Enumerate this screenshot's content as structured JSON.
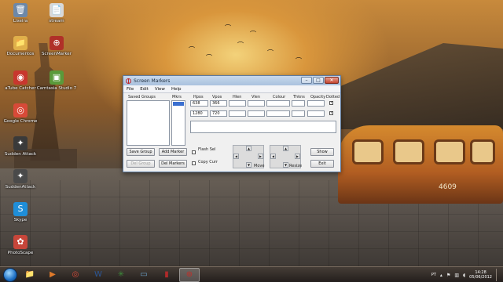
{
  "desktop": {
    "icons": [
      {
        "label": "Lixeira",
        "glyph": "🗑",
        "color": "#6d88a8"
      },
      {
        "label": "stream",
        "glyph": "📄",
        "color": "#d8d8d8"
      },
      {
        "label": "Documentos",
        "glyph": "📁",
        "color": "#e0b04a"
      },
      {
        "label": "ScreenMarker",
        "glyph": "⊕",
        "color": "#b03028"
      },
      {
        "label": "aTube Catcher",
        "glyph": "◉",
        "color": "#c8372e"
      },
      {
        "label": "Camtasia Studio 7",
        "glyph": "▣",
        "color": "#5a9a3a"
      },
      {
        "label": "Google Chrome",
        "glyph": "◎",
        "color": "#d84a38"
      },
      {
        "label": "Sudden Attack",
        "glyph": "✦",
        "color": "#3a3a3a"
      },
      {
        "label": "SuddenAttack",
        "glyph": "✦",
        "color": "#4a4a4a"
      },
      {
        "label": "Skype",
        "glyph": "S",
        "color": "#1f8ed8"
      },
      {
        "label": "PhotoScape",
        "glyph": "✿",
        "color": "#c7463a"
      }
    ],
    "train_number": "4609"
  },
  "window": {
    "title": "Screen Markers",
    "controls": {
      "minimize": "–",
      "maximize": "□",
      "close": "✕"
    },
    "menu": [
      "File",
      "Edit",
      "View",
      "Help"
    ],
    "saved_groups_label": "Saved Groups",
    "mkrs_label": "Mkrs",
    "columns": [
      "Hpos",
      "Vpos",
      "Hlen",
      "Vlen",
      "Colour",
      "Thkns",
      "Opacity",
      "Dotted"
    ],
    "rows": [
      {
        "hpos": "638",
        "vpos": "366",
        "hlen": "",
        "vlen": "",
        "colour": "",
        "thkns": "",
        "opacity": "",
        "dotted": "✓"
      },
      {
        "hpos": "1280",
        "vpos": "720",
        "hlen": "",
        "vlen": "",
        "colour": "",
        "thkns": "",
        "opacity": "",
        "dotted": "✓"
      }
    ],
    "buttons": {
      "save_group": "Save Group",
      "add_marker": "Add Marker",
      "del_group": "Del Group",
      "del_markers": "Del Markers",
      "show": "Show",
      "exit": "Exit"
    },
    "checkboxes": {
      "flash_sel": "Flash Sel",
      "copy_curr": "Copy Curr"
    },
    "pad_labels": {
      "move": "Move",
      "resize": "Resize"
    },
    "arrows": {
      "up": "▲",
      "down": "▼",
      "left": "◀",
      "right": "▶"
    }
  },
  "taskbar": {
    "apps": [
      {
        "name": "file-explorer",
        "glyph": "📁"
      },
      {
        "name": "media-player",
        "glyph": "▶"
      },
      {
        "name": "chrome",
        "glyph": "◎"
      },
      {
        "name": "word",
        "glyph": "W"
      },
      {
        "name": "network-app",
        "glyph": "✳"
      },
      {
        "name": "window-app",
        "glyph": "▭"
      },
      {
        "name": "recorder",
        "glyph": "▮"
      },
      {
        "name": "screen-markers",
        "glyph": "⊕"
      }
    ],
    "language": "PT",
    "time": "14:28",
    "date": "05/06/2012"
  }
}
